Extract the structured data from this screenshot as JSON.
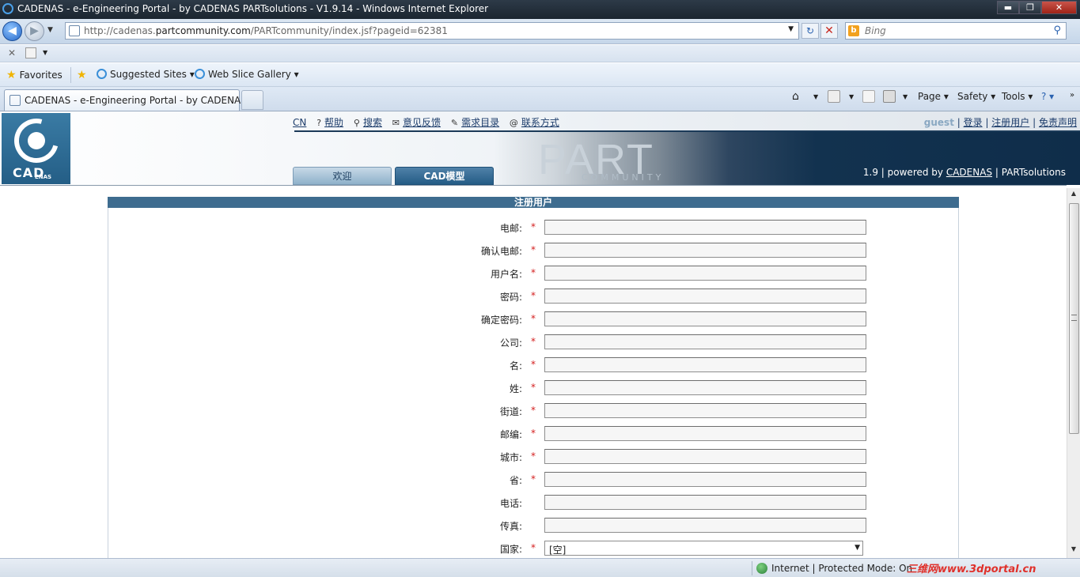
{
  "window": {
    "title": "CADENAS - e-Engineering Portal - by CADENAS PARTsolutions - V1.9.14 - Windows Internet Explorer",
    "minimize": "▬",
    "restore": "❐",
    "close": "✕"
  },
  "address": {
    "url_prefix": "http://cadenas.",
    "url_domain": "partcommunity.com",
    "url_path": "/PARTcommunity/index.jsf?pageid=62381",
    "search_placeholder": "Bing"
  },
  "favorites": {
    "favorites_label": "Favorites",
    "suggested_sites": "Suggested Sites",
    "web_slice_gallery": "Web Slice Gallery"
  },
  "tab": {
    "label": "CADENAS - e-Engineering Portal - by CADENAS ..."
  },
  "command_bar": {
    "page": "Page",
    "safety": "Safety",
    "tools": "Tools"
  },
  "site": {
    "logo_text": "CAD",
    "logo_sub": "ENAS",
    "lang": "CN",
    "nav_links": [
      "帮助",
      "搜索",
      "意见反馈",
      "需求目录",
      "联系方式"
    ],
    "guest": "guest",
    "login": "登录",
    "register": "注册用户",
    "disclaimer": "免责声明",
    "banner_part": "PART",
    "banner_community": "COMMUNITY",
    "version": "1.9",
    "powered_by": "powered by",
    "cadenas_link": "CADENAS",
    "partsolutions": "PARTsolutions",
    "tabs": [
      "欢迎",
      "CAD模型"
    ]
  },
  "form": {
    "heading": "注册用户",
    "required_mark": "*",
    "fields": [
      {
        "label": "电邮:",
        "required": true,
        "value": ""
      },
      {
        "label": "确认电邮:",
        "required": true,
        "value": ""
      },
      {
        "label": "用户名:",
        "required": true,
        "value": ""
      },
      {
        "label": "密码:",
        "required": true,
        "value": ""
      },
      {
        "label": "确定密码:",
        "required": true,
        "value": ""
      },
      {
        "label": "公司:",
        "required": true,
        "value": ""
      },
      {
        "label": "名:",
        "required": true,
        "value": ""
      },
      {
        "label": "姓:",
        "required": true,
        "value": ""
      },
      {
        "label": "街道:",
        "required": true,
        "value": ""
      },
      {
        "label": "邮编:",
        "required": true,
        "value": ""
      },
      {
        "label": "城市:",
        "required": true,
        "value": ""
      },
      {
        "label": "省:",
        "required": true,
        "value": ""
      },
      {
        "label": "电话:",
        "required": false,
        "value": ""
      },
      {
        "label": "传真:",
        "required": false,
        "value": ""
      }
    ],
    "country_label": "国家:",
    "country_value": "[空]"
  },
  "status": {
    "zone": "Internet | Protected Mode: On",
    "watermark": "三维网www.3dportal.cn"
  }
}
